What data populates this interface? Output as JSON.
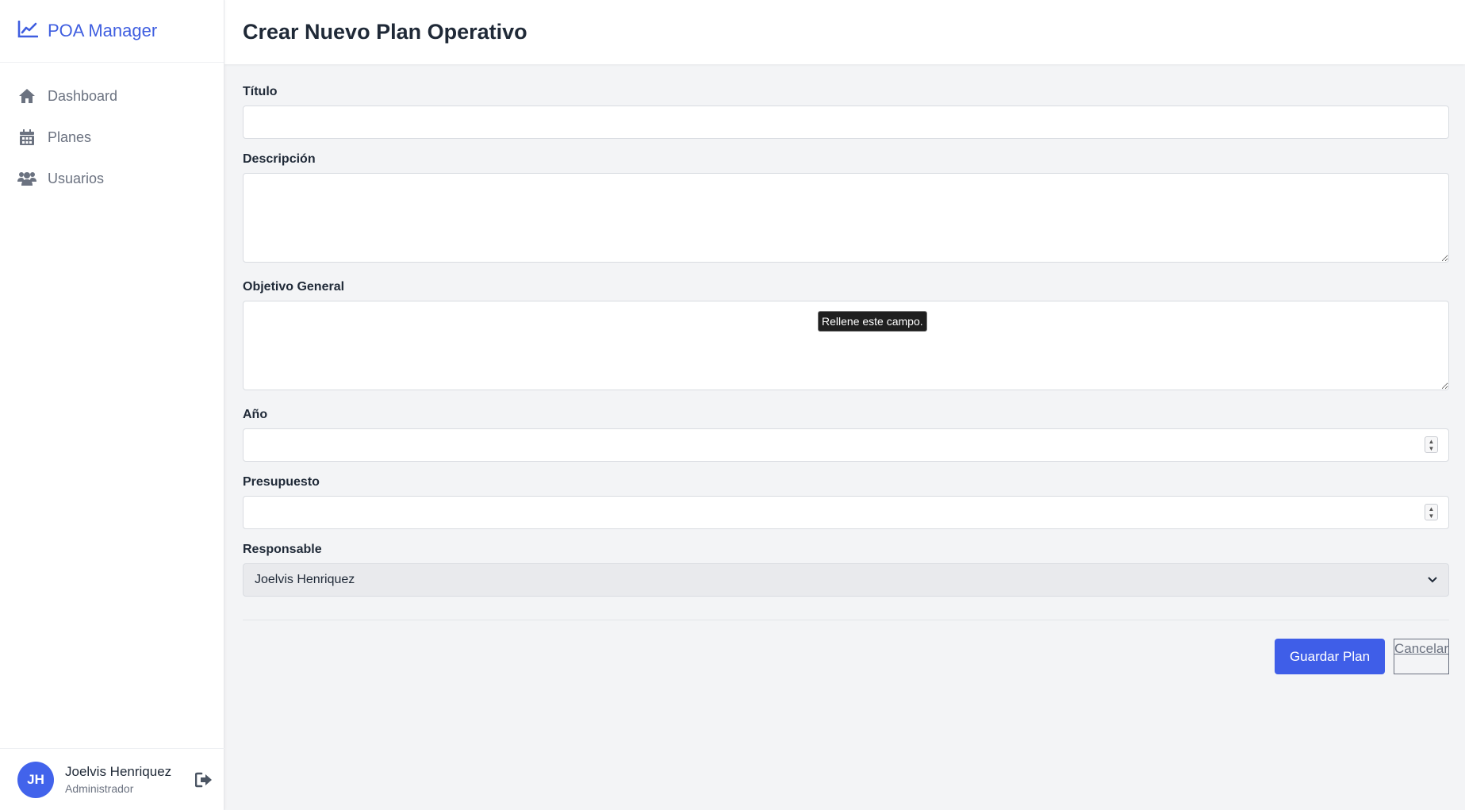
{
  "sidebar": {
    "brand": "POA Manager",
    "items": [
      {
        "label": "Dashboard",
        "icon": "home-icon"
      },
      {
        "label": "Planes",
        "icon": "calendar-icon"
      },
      {
        "label": "Usuarios",
        "icon": "users-icon"
      }
    ],
    "user": {
      "initials": "JH",
      "name": "Joelvis Henriquez",
      "role": "Administrador"
    }
  },
  "header": {
    "title": "Crear Nuevo Plan Operativo"
  },
  "form": {
    "titulo_label": "Título",
    "titulo_value": "",
    "descripcion_label": "Descripción",
    "descripcion_value": "",
    "objetivo_label": "Objetivo General",
    "objetivo_value": "",
    "anio_label": "Año",
    "anio_value": "",
    "presupuesto_label": "Presupuesto",
    "presupuesto_value": "",
    "responsable_label": "Responsable",
    "responsable_value": "Joelvis Henriquez",
    "tooltip": "Rellene este campo.",
    "save_label": "Guardar Plan",
    "cancel_label": "Cancelar"
  },
  "colors": {
    "accent": "#3f5ee8",
    "brand": "#3f5ee0"
  }
}
